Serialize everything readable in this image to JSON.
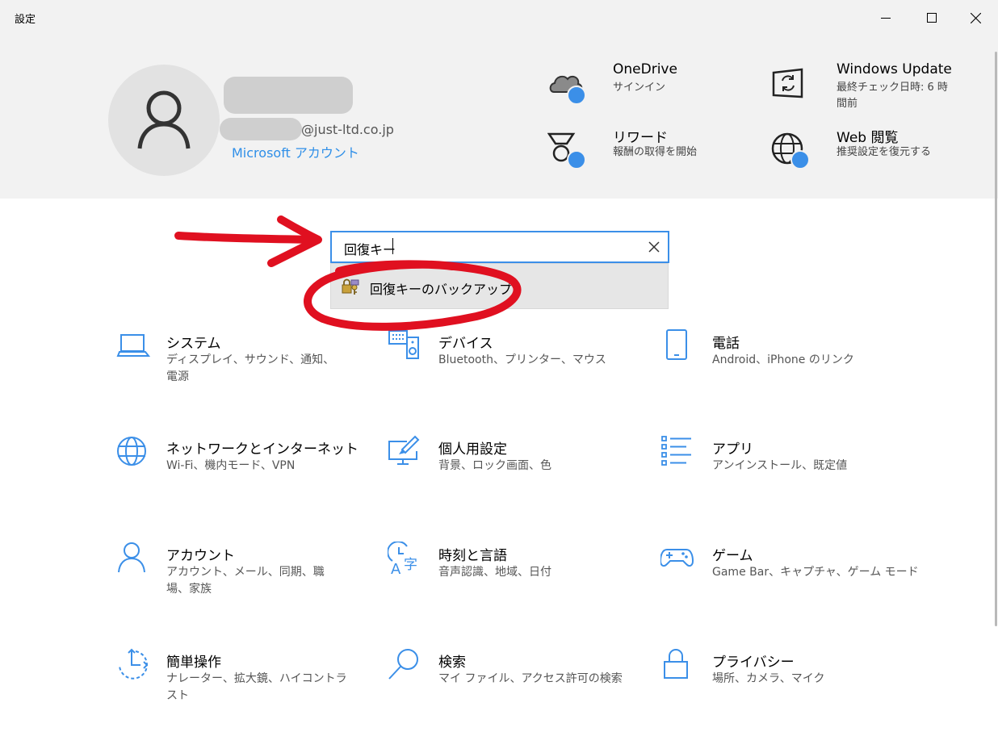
{
  "window": {
    "title": "設定",
    "controls": {
      "minimize": "minimize-icon",
      "maximize": "maximize-icon",
      "close": "close-icon"
    }
  },
  "account": {
    "email_suffix": "@just-ltd.co.jp",
    "link": "Microsoft アカウント"
  },
  "header_items": [
    {
      "title": "OneDrive",
      "subtitle": "サインイン",
      "icon": "onedrive-cloud-icon"
    },
    {
      "title": "Windows Update",
      "subtitle": "最終チェック日時: 6 時間前",
      "icon": "windows-update-icon"
    },
    {
      "title": "リワード",
      "subtitle": "報酬の取得を開始",
      "icon": "rewards-medal-icon"
    },
    {
      "title": "Web 閲覧",
      "subtitle": "推奨設定を復元する",
      "icon": "globe-icon"
    }
  ],
  "search": {
    "value": "回復キー",
    "suggestion": "回復キーのバックアップ"
  },
  "categories": [
    {
      "name": "システム",
      "desc": "ディスプレイ、サウンド、通知、電源",
      "icon": "laptop-icon"
    },
    {
      "name": "デバイス",
      "desc": "Bluetooth、プリンター、マウス",
      "icon": "keyboard-speaker-icon"
    },
    {
      "name": "電話",
      "desc": "Android、iPhone のリンク",
      "icon": "phone-icon"
    },
    {
      "name": "ネットワークとインターネット",
      "desc": "Wi-Fi、機内モード、VPN",
      "icon": "globe-icon"
    },
    {
      "name": "個人用設定",
      "desc": "背景、ロック画面、色",
      "icon": "paint-brush-icon"
    },
    {
      "name": "アプリ",
      "desc": "アンインストール、既定値",
      "icon": "app-list-icon"
    },
    {
      "name": "アカウント",
      "desc": "アカウント、メール、同期、職場、家族",
      "icon": "person-icon"
    },
    {
      "name": "時刻と言語",
      "desc": "音声認識、地域、日付",
      "icon": "time-language-icon"
    },
    {
      "name": "ゲーム",
      "desc": "Game Bar、キャプチャ、ゲーム モード",
      "icon": "gamepad-icon"
    },
    {
      "name": "簡単操作",
      "desc": "ナレーター、拡大鏡、ハイコントラスト",
      "icon": "ease-of-access-icon"
    },
    {
      "name": "検索",
      "desc": "マイ ファイル、アクセス許可の検索",
      "icon": "magnifier-icon"
    },
    {
      "name": "プライバシー",
      "desc": "場所、カメラ、マイク",
      "icon": "padlock-icon"
    }
  ],
  "colors": {
    "accent": "#3b8fe8",
    "header_bg": "#f2f2f2",
    "annotation": "#e01020"
  }
}
